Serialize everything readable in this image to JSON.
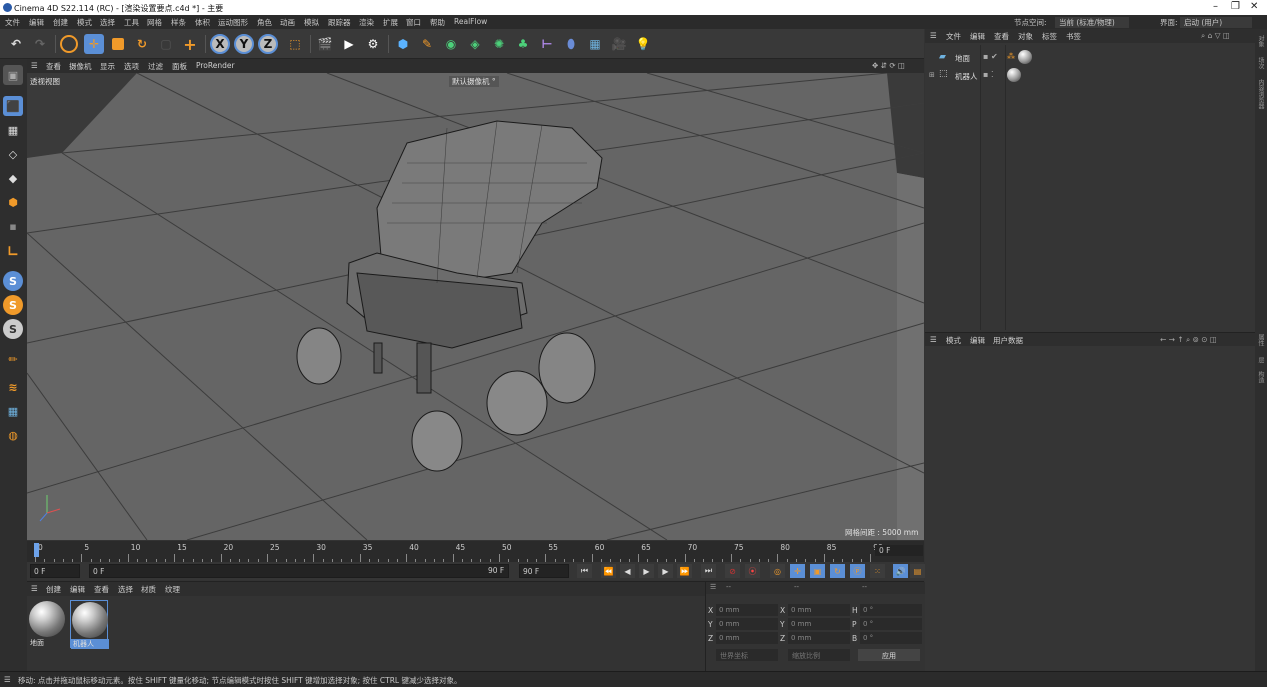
{
  "window": {
    "title": "Cinema 4D S22.114 (RC) - [渲染设置要点.c4d *] - 主要",
    "controls": [
      "–",
      "❐",
      "✕"
    ]
  },
  "menubar": {
    "items": [
      "文件",
      "编辑",
      "创建",
      "模式",
      "选择",
      "工具",
      "网格",
      "样条",
      "体积",
      "运动图形",
      "角色",
      "动画",
      "模拟",
      "跟踪器",
      "渲染",
      "扩展",
      "窗口",
      "帮助",
      "RealFlow"
    ],
    "node_space_label": "节点空间:",
    "node_space_value": "当前 (标准/物理)",
    "layout_label": "界面:",
    "layout_value": "启动 (用户)"
  },
  "viewport": {
    "menu": [
      "查看",
      "摄像机",
      "显示",
      "选项",
      "过滤",
      "面板",
      "ProRender"
    ],
    "view_name": "透视视图",
    "camera_label": "默认摄像机 °",
    "grid_spacing": "网格间距 : 5000 mm"
  },
  "timeline": {
    "ticks": [
      "0",
      "5",
      "10",
      "15",
      "20",
      "25",
      "30",
      "35",
      "40",
      "45",
      "50",
      "55",
      "60",
      "65",
      "70",
      "75",
      "80",
      "85",
      "90"
    ],
    "frame_field": "0 F"
  },
  "playback": {
    "start_frame": "0 F",
    "current_frame": "0 F",
    "end_frame": "90 F",
    "max_frame": "90 F"
  },
  "object_manager": {
    "menu": [
      "文件",
      "编辑",
      "查看",
      "对象",
      "标签",
      "书签"
    ],
    "objects": [
      {
        "name": "地面"
      },
      {
        "name": "机器人"
      }
    ]
  },
  "attribute_manager": {
    "menu": [
      "模式",
      "编辑",
      "用户数据"
    ]
  },
  "right_strip": {
    "tabs": [
      "对象",
      "场次",
      "内容浏览器",
      "属性",
      "层",
      "构造"
    ]
  },
  "material_manager": {
    "menu": [
      "创建",
      "编辑",
      "查看",
      "选择",
      "材质",
      "纹理"
    ],
    "materials": [
      {
        "name": "地面"
      },
      {
        "name": "机器人"
      }
    ]
  },
  "coordinates": {
    "header": [
      "--",
      "--",
      "--"
    ],
    "rows": [
      {
        "a1": "X",
        "v1": "0 mm",
        "a2": "X",
        "v2": "0 mm",
        "a3": "H",
        "v3": "0 °"
      },
      {
        "a1": "Y",
        "v1": "0 mm",
        "a2": "Y",
        "v2": "0 mm",
        "a3": "P",
        "v3": "0 °"
      },
      {
        "a1": "Z",
        "v1": "0 mm",
        "a2": "Z",
        "v2": "0 mm",
        "a3": "B",
        "v3": "0 °"
      }
    ],
    "coord_system": "世界坐标",
    "scale_mode": "缩放比例",
    "apply_button": "应用"
  },
  "statusbar": {
    "text": "移动: 点击并拖动鼠标移动元素。按住 SHIFT 键量化移动; 节点编辑模式时按住 SHIFT 键增加选择对象; 按住 CTRL 键减少选择对象。"
  },
  "colors": {
    "accent_blue": "#5b8fd6",
    "accent_orange": "#f09a2a",
    "panel_bg": "#353535",
    "viewport_bg": "#646464"
  }
}
